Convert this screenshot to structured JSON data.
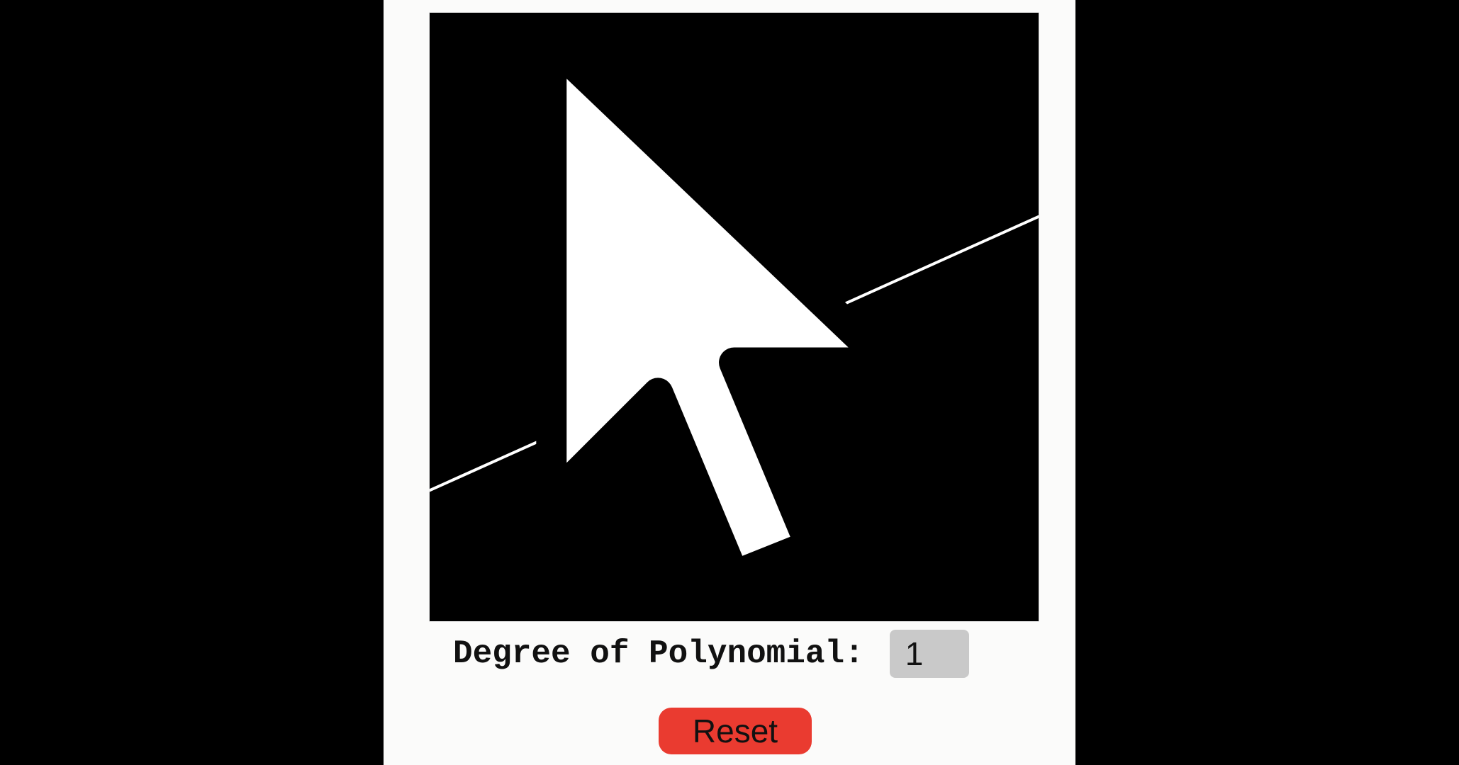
{
  "controls": {
    "degree_label": "Degree of Polynomial:",
    "degree_value": "1",
    "reset_label": "Reset"
  },
  "colors": {
    "canvas_background": "#000000",
    "curve": "#ffffff",
    "reset_button": "#ea3b30",
    "degree_input_background": "#c9c9c9"
  },
  "canvas": {
    "curve_points": [
      {
        "x": 0.0,
        "y": 0.215
      },
      {
        "x": 1.0,
        "y": 0.665
      }
    ]
  }
}
